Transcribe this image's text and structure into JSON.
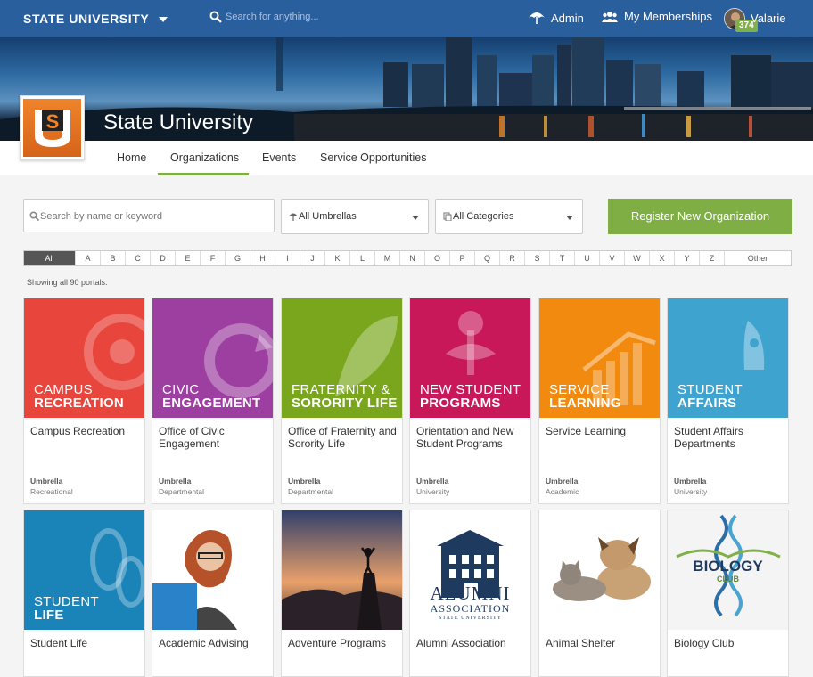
{
  "header": {
    "brand": "STATE UNIVERSITY",
    "search_placeholder": "Search for anything...",
    "admin_label": "Admin",
    "memberships_label": "My Memberships",
    "user_name": "Valarie",
    "badge_count": "374"
  },
  "banner": {
    "site_title": "State University",
    "logo_letter": "S"
  },
  "nav": {
    "items": [
      "Home",
      "Organizations",
      "Events",
      "Service Opportunities"
    ],
    "active": "Organizations"
  },
  "filters": {
    "search_placeholder": "Search by name or keyword",
    "umbrella_select": "All Umbrellas",
    "category_select": "All Categories",
    "register_label": "Register New Organization"
  },
  "alphabet": [
    "All",
    "A",
    "B",
    "C",
    "D",
    "E",
    "F",
    "G",
    "H",
    "I",
    "J",
    "K",
    "L",
    "M",
    "N",
    "O",
    "P",
    "Q",
    "R",
    "S",
    "T",
    "U",
    "V",
    "W",
    "X",
    "Y",
    "Z",
    "Other"
  ],
  "showing_text": "Showing all 90 portals.",
  "umbrella_word": "Umbrella",
  "cards": [
    {
      "name": "Campus Recreation",
      "img_line1": "CAMPUS",
      "img_line2": "RECREATION",
      "umbrella": "Recreational",
      "color": "#e8453c"
    },
    {
      "name": "Office of Civic Engagement",
      "img_line1": "CIVIC",
      "img_line2": "ENGAGEMENT",
      "umbrella": "Departmental",
      "color": "#9c3fa0"
    },
    {
      "name": "Office of Fraternity and Sorority Life",
      "img_line1": "FRATERNITY &",
      "img_line2": "SORORITY LIFE",
      "umbrella": "Departmental",
      "color": "#7aa61e"
    },
    {
      "name": "Orientation and New Student Programs",
      "img_line1": "NEW STUDENT",
      "img_line2": "PROGRAMS",
      "umbrella": "University",
      "color": "#c8185a"
    },
    {
      "name": "Service Learning",
      "img_line1": "SERVICE",
      "img_line2": "LEARNING",
      "umbrella": "Academic",
      "color": "#f28a0f"
    },
    {
      "name": "Student Affairs Departments",
      "img_line1": "STUDENT",
      "img_line2": "AFFAIRS",
      "umbrella": "University",
      "color": "#3ea3cf"
    },
    {
      "name": "Student Life",
      "img_line1": "STUDENT",
      "img_line2": "LIFE",
      "umbrella": "",
      "color": "#1a83b8"
    },
    {
      "name": "Academic Advising",
      "img_line1": "",
      "img_line2": "",
      "umbrella": "",
      "color": "#ffffff"
    },
    {
      "name": "Adventure Programs",
      "img_line1": "",
      "img_line2": "",
      "umbrella": "",
      "color": "#e58a4c"
    },
    {
      "name": "Alumni Association",
      "img_line1": "",
      "img_line2": "",
      "umbrella": "",
      "color": "#ffffff"
    },
    {
      "name": "Animal Shelter",
      "img_line1": "",
      "img_line2": "",
      "umbrella": "",
      "color": "#ffffff"
    },
    {
      "name": "Biology Club",
      "img_line1": "",
      "img_line2": "",
      "umbrella": "",
      "color": "#f4f4f4"
    }
  ],
  "alumni_logo": {
    "line1": "ALUMNI",
    "line2": "ASSOCIATION",
    "line3": "STATE UNIVERSITY"
  },
  "biology_logo": {
    "line1": "BIOLOGY",
    "line2": "CLUB"
  },
  "colors": {
    "topbar": "#2a5f9e",
    "accent": "#7fae45",
    "logo_orange": "#e8742a"
  }
}
